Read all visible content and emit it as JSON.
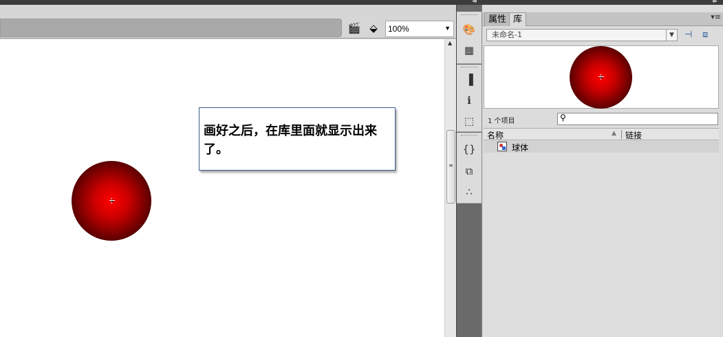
{
  "window": {
    "collapse_left": "◂◂",
    "collapse_right": "▸▸"
  },
  "editbar": {
    "edit_scene_icon": "clapperboard-icon",
    "edit_symbol_icon": "shapes-icon",
    "zoom": "100%"
  },
  "stage": {
    "note_text": "画好之后，在库里面就显示出来了。",
    "ball_colors": {
      "center": "#ff0000",
      "edge": "#000000"
    }
  },
  "tools": [
    {
      "name": "palette-icon",
      "glyph": "🎨"
    },
    {
      "name": "swatches-icon",
      "glyph": "▦"
    },
    {
      "name": "align-icon",
      "glyph": "▐"
    },
    {
      "name": "info-icon",
      "glyph": "ℹ"
    },
    {
      "name": "transform-icon",
      "glyph": "⬚"
    },
    {
      "name": "actions-icon",
      "glyph": "{}"
    },
    {
      "name": "components-icon",
      "glyph": "⧉"
    },
    {
      "name": "motion-presets-icon",
      "glyph": "∴"
    }
  ],
  "library": {
    "tabs": [
      "属性",
      "库"
    ],
    "active_tab": "库",
    "document": "未命名-1",
    "item_count": "1 个项目",
    "search_placeholder": "",
    "columns": {
      "name": "名称",
      "linkage": "链接"
    },
    "items": [
      {
        "name": "球体",
        "type": "movie-clip-symbol"
      }
    ]
  }
}
